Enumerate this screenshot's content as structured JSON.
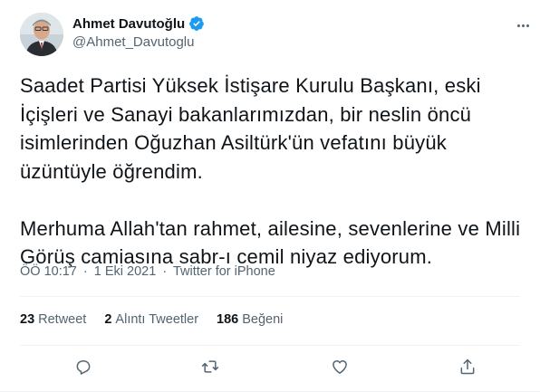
{
  "author": {
    "name": "Ahmet Davutoğlu",
    "handle": "@Ahmet_Davutoglu",
    "verified_icon": "verified-badge-icon"
  },
  "tweet": {
    "text": "Saadet Partisi Yüksek İstişare Kurulu Başkanı, eski İçişleri ve Sanayi bakanlarımızdan, bir neslin öncü isimlerinden Oğuzhan Asiltürk'ün vefatını büyük üzüntüyle öğrendim.\n\nMerhuma Allah'tan rahmet, ailesine, sevenlerine ve Milli Görüş camiasına sabr-ı cemil niyaz ediyorum.",
    "time": "ÖÖ 10:17",
    "date": "1 Eki 2021",
    "source": "Twitter for iPhone",
    "separator": "·"
  },
  "stats": {
    "retweets_count": "23",
    "retweets_label": "Retweet",
    "quotes_count": "2",
    "quotes_label": "Alıntı Tweetler",
    "likes_count": "186",
    "likes_label": "Beğeni"
  },
  "icons": {
    "reply": "reply-icon",
    "retweet": "retweet-icon",
    "like": "heart-icon",
    "share": "share-icon",
    "more": "more-icon"
  },
  "colors": {
    "accent": "#1d9bf0",
    "secondary_text": "#536471",
    "primary_text": "#0f1419"
  }
}
